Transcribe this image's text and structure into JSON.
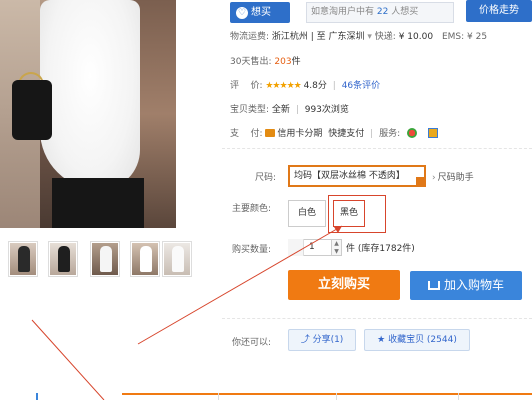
{
  "topbar": {
    "want_label": "想买",
    "want_icon": "heart-icon",
    "invite_prefix": "如意淘用户中有",
    "invite_count": "22",
    "invite_suffix": "人想买",
    "price_trend_label": "价格走势"
  },
  "shipping": {
    "label": "物流运费:",
    "route": "浙江杭州 | 至  广东深圳",
    "express_label": "快递:",
    "express_price": "¥ 10.00",
    "ems_label": "EMS: ¥ 25"
  },
  "sales": {
    "label": "30天售出:",
    "count": "203",
    "unit": "件"
  },
  "rating": {
    "label": "评    价:",
    "stars": "★★★★★",
    "score": "4.8分",
    "reviews_count": "46",
    "reviews_suffix": "条评价"
  },
  "type": {
    "label": "宝贝类型:",
    "condition": "全新",
    "views": "993",
    "views_suffix": "次浏览"
  },
  "payment": {
    "label": "支    付:",
    "credit_card": "信用卡分期",
    "quick_pay": "快捷支付",
    "service_label": "服务:"
  },
  "options": {
    "size_label": "尺码:",
    "size_value": "均码【双层冰丝棉 不透肉】",
    "size_guide": "尺码助手",
    "color_label": "主要颜色:",
    "colors": [
      "白色",
      "黑色"
    ],
    "selected_color": "黑色"
  },
  "quantity": {
    "label": "购买数量:",
    "value": "1",
    "unit": "件",
    "stock": "(库存1782件)"
  },
  "actions": {
    "buy_now": "立刻购买",
    "add_to_cart": "加入购物车"
  },
  "social": {
    "label": "你还可以:",
    "share": "分享(1)",
    "favorite": "收藏宝贝 (2544)"
  },
  "colors_theme": {
    "accent_orange": "#f07a12",
    "accent_blue": "#2e6fc9",
    "annotation_red": "#d7452c"
  }
}
